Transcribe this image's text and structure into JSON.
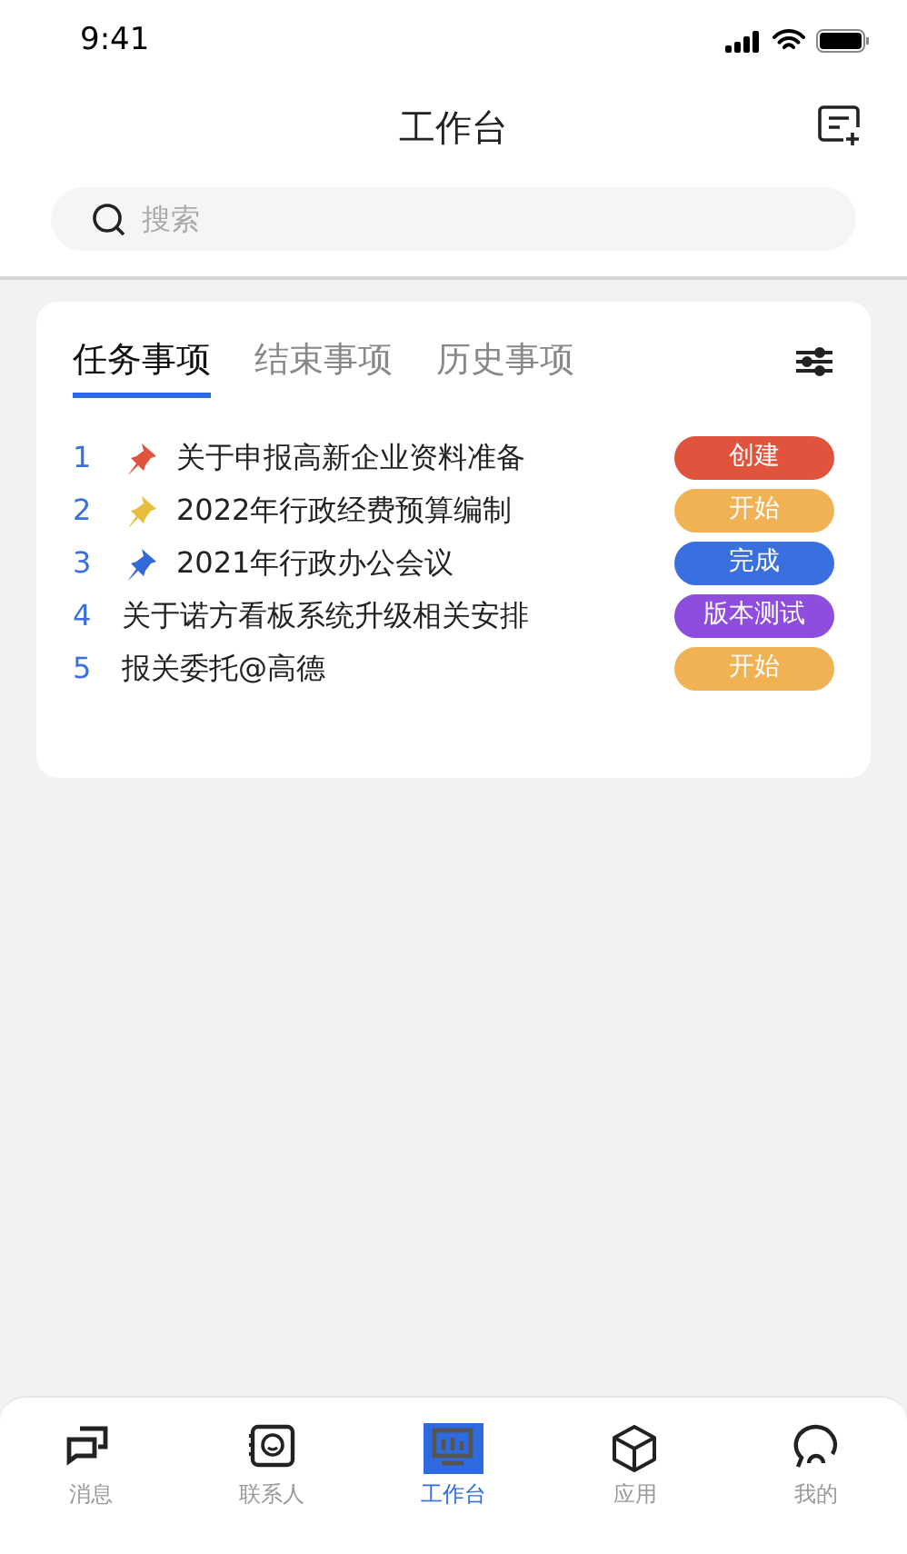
{
  "status_bar": {
    "time": "9:41"
  },
  "header": {
    "title": "工作台"
  },
  "search": {
    "placeholder": "搜索"
  },
  "tabs": [
    {
      "label": "任务事项",
      "selected": true
    },
    {
      "label": "结束事项",
      "selected": false
    },
    {
      "label": "历史事项",
      "selected": false
    }
  ],
  "tasks": [
    {
      "index": "1",
      "pin": {
        "color": "#e0533d"
      },
      "title": "关于申报高新企业资料准备",
      "status": "创建",
      "color": "#e0533d"
    },
    {
      "index": "2",
      "pin": {
        "color": "#e8bc3c"
      },
      "title": "2022年行政经费预算编制",
      "status": "开始",
      "color": "#f0b253"
    },
    {
      "index": "3",
      "pin": {
        "color": "#3368d8"
      },
      "title": "2021年行政办公会议",
      "status": "完成",
      "color": "#3a6fe0"
    },
    {
      "index": "4",
      "title": "关于诺方看板系统升级相关安排",
      "status": "版本测试",
      "color": "#8e4ddc"
    },
    {
      "index": "5",
      "title": "报关委托@高德",
      "status": "开始",
      "color": "#f0b253"
    }
  ],
  "bottom_nav": [
    {
      "kind": "messages",
      "label": "消息",
      "selected": false
    },
    {
      "kind": "contacts",
      "label": "联系人",
      "selected": false
    },
    {
      "kind": "workbench",
      "label": "工作台",
      "selected": true
    },
    {
      "kind": "apps",
      "label": "应用",
      "selected": false
    },
    {
      "kind": "me",
      "label": "我的",
      "selected": false
    }
  ]
}
